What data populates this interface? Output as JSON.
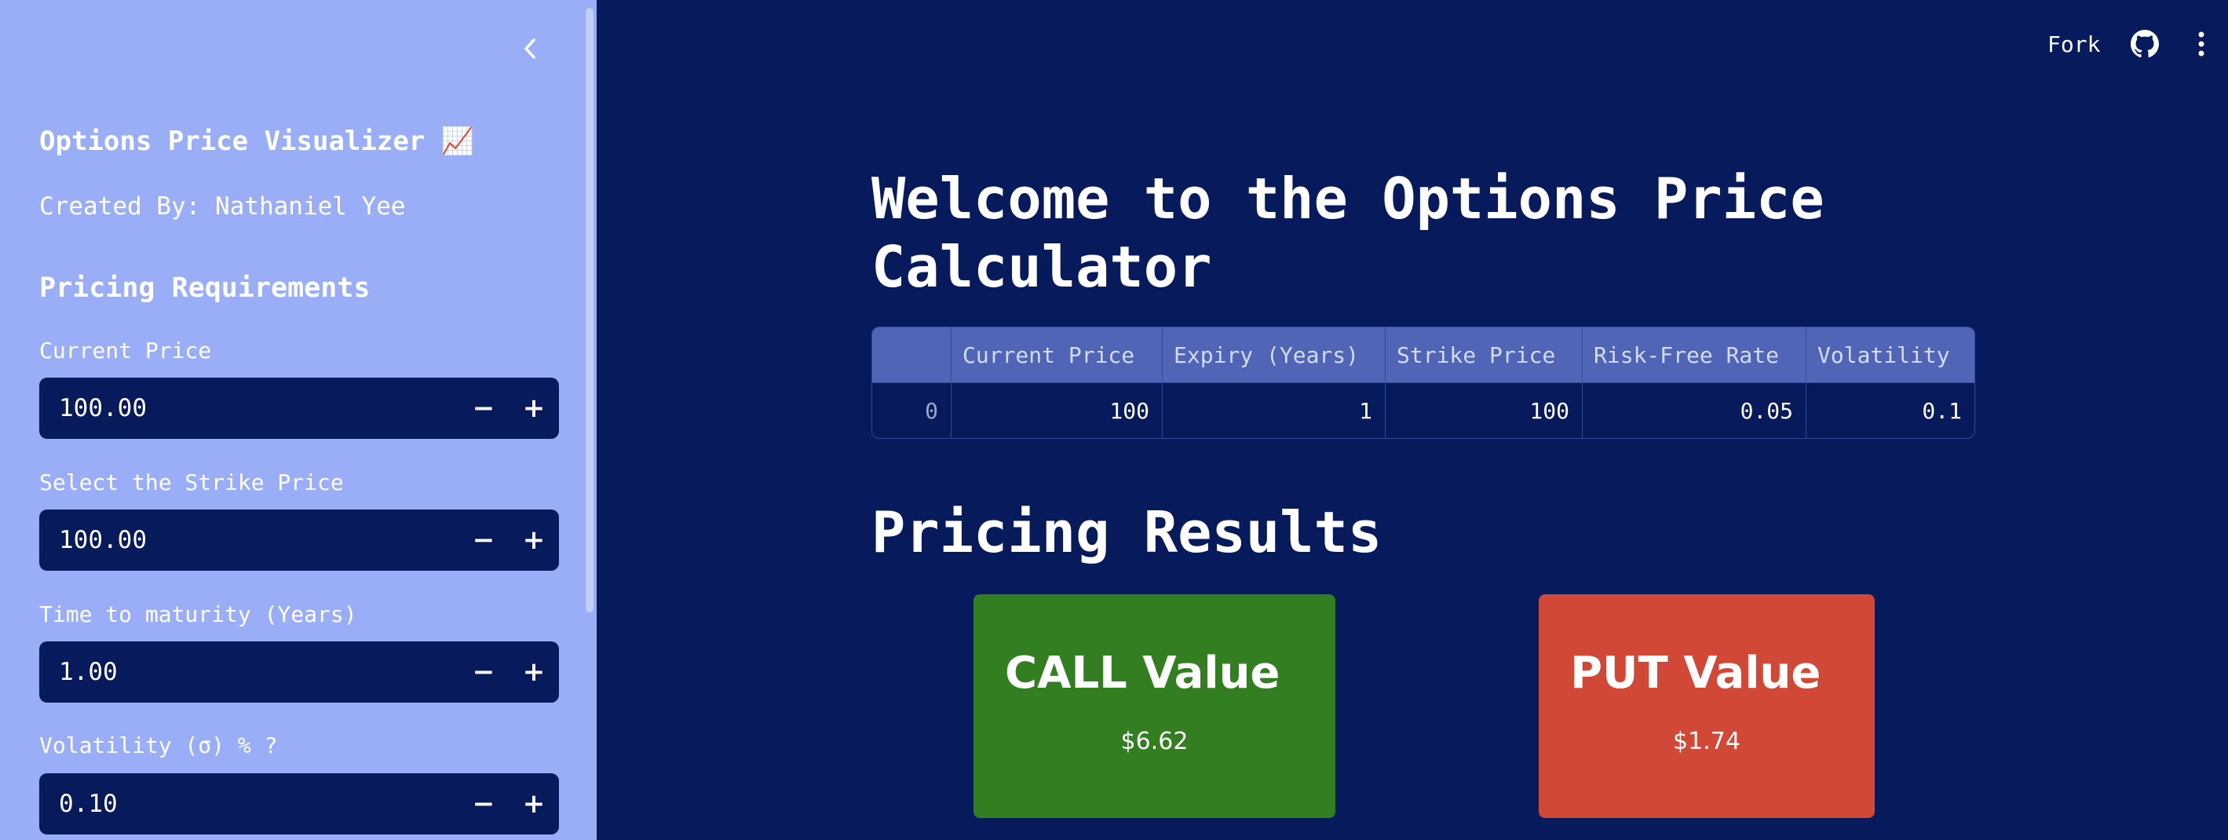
{
  "sidebar": {
    "title": "Options Price Visualizer 📈",
    "created_by": "Created By: Nathaniel Yee",
    "section": "Pricing Requirements",
    "fields": [
      {
        "label": "Current Price",
        "value": "100.00"
      },
      {
        "label": "Select the Strike Price",
        "value": "100.00"
      },
      {
        "label": "Time to maturity (Years)",
        "value": "1.00"
      },
      {
        "label": "Volatility (σ) % ?",
        "value": "0.10"
      }
    ],
    "minus": "−",
    "plus": "+"
  },
  "header": {
    "fork_label": "Fork",
    "icons": [
      "github-icon",
      "more-vertical-icon"
    ]
  },
  "main": {
    "title": "Welcome to the Options Price Calculator",
    "table": {
      "headers": [
        "",
        "Current Price",
        "Expiry (Years)",
        "Strike Price",
        "Risk-Free Rate",
        "Volatility"
      ],
      "rows": [
        [
          "0",
          "100",
          "1",
          "100",
          "0.05",
          "0.1"
        ]
      ]
    },
    "results_title": "Pricing Results",
    "call": {
      "label": "CALL Value",
      "value": "$6.62",
      "color": "#347e22"
    },
    "put": {
      "label": "PUT Value",
      "value": "$1.74",
      "color": "#d24837"
    }
  },
  "colors": {
    "background": "#061a5c",
    "sidebar": "#9aaef7",
    "table_header": "#5065b5"
  }
}
